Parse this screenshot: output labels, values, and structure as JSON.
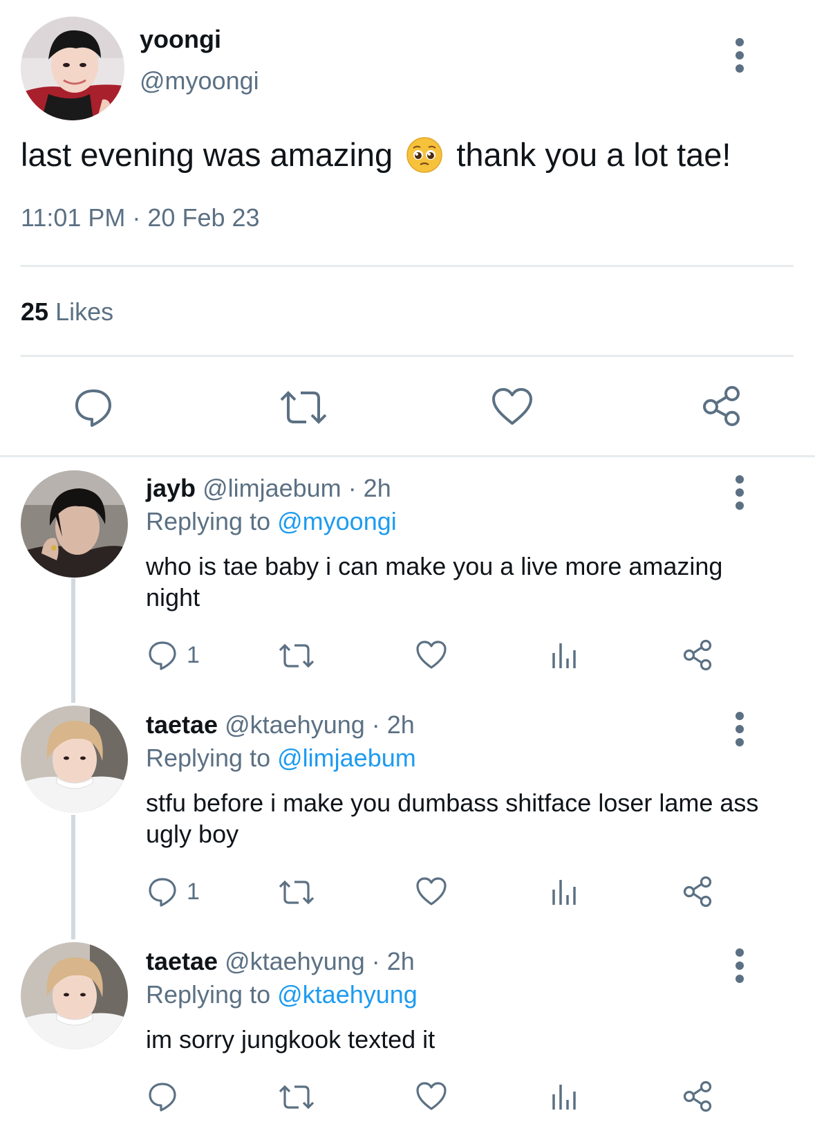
{
  "main_tweet": {
    "display_name": "yoongi",
    "handle": "@myoongi",
    "text_before_emoji": "last evening was amazing",
    "emoji_icon": "pleading-face-emoji",
    "text_after_emoji": "thank you a lot tae!",
    "timestamp": "11:01 PM · 20 Feb 23",
    "likes_count": "25",
    "likes_label": "Likes",
    "actions": [
      "reply-icon",
      "retweet-icon",
      "like-icon",
      "share-icon"
    ]
  },
  "replies": [
    {
      "display_name": "jayb",
      "handle": "@limjaebum",
      "time": "· 2h",
      "replying_label": "Replying to",
      "replying_to": "@myoongi",
      "text": "who is tae baby i can make you a live more amazing night",
      "reply_count": "1"
    },
    {
      "display_name": "taetae",
      "handle": "@ktaehyung",
      "time": "· 2h",
      "replying_label": "Replying to",
      "replying_to": "@limjaebum",
      "text": "stfu before i make you dumbass shitface loser lame ass ugly boy",
      "reply_count": "1"
    },
    {
      "display_name": "taetae",
      "handle": "@ktaehyung",
      "time": "· 2h",
      "replying_label": "Replying to",
      "replying_to": "@ktaehyung",
      "text": "im sorry jungkook texted it",
      "reply_count": ""
    }
  ],
  "colors": {
    "text": "#0f1419",
    "muted": "#5b7083",
    "link": "#1d9bf0",
    "divider": "#e7ebee",
    "thread_line": "#cfd9de"
  }
}
